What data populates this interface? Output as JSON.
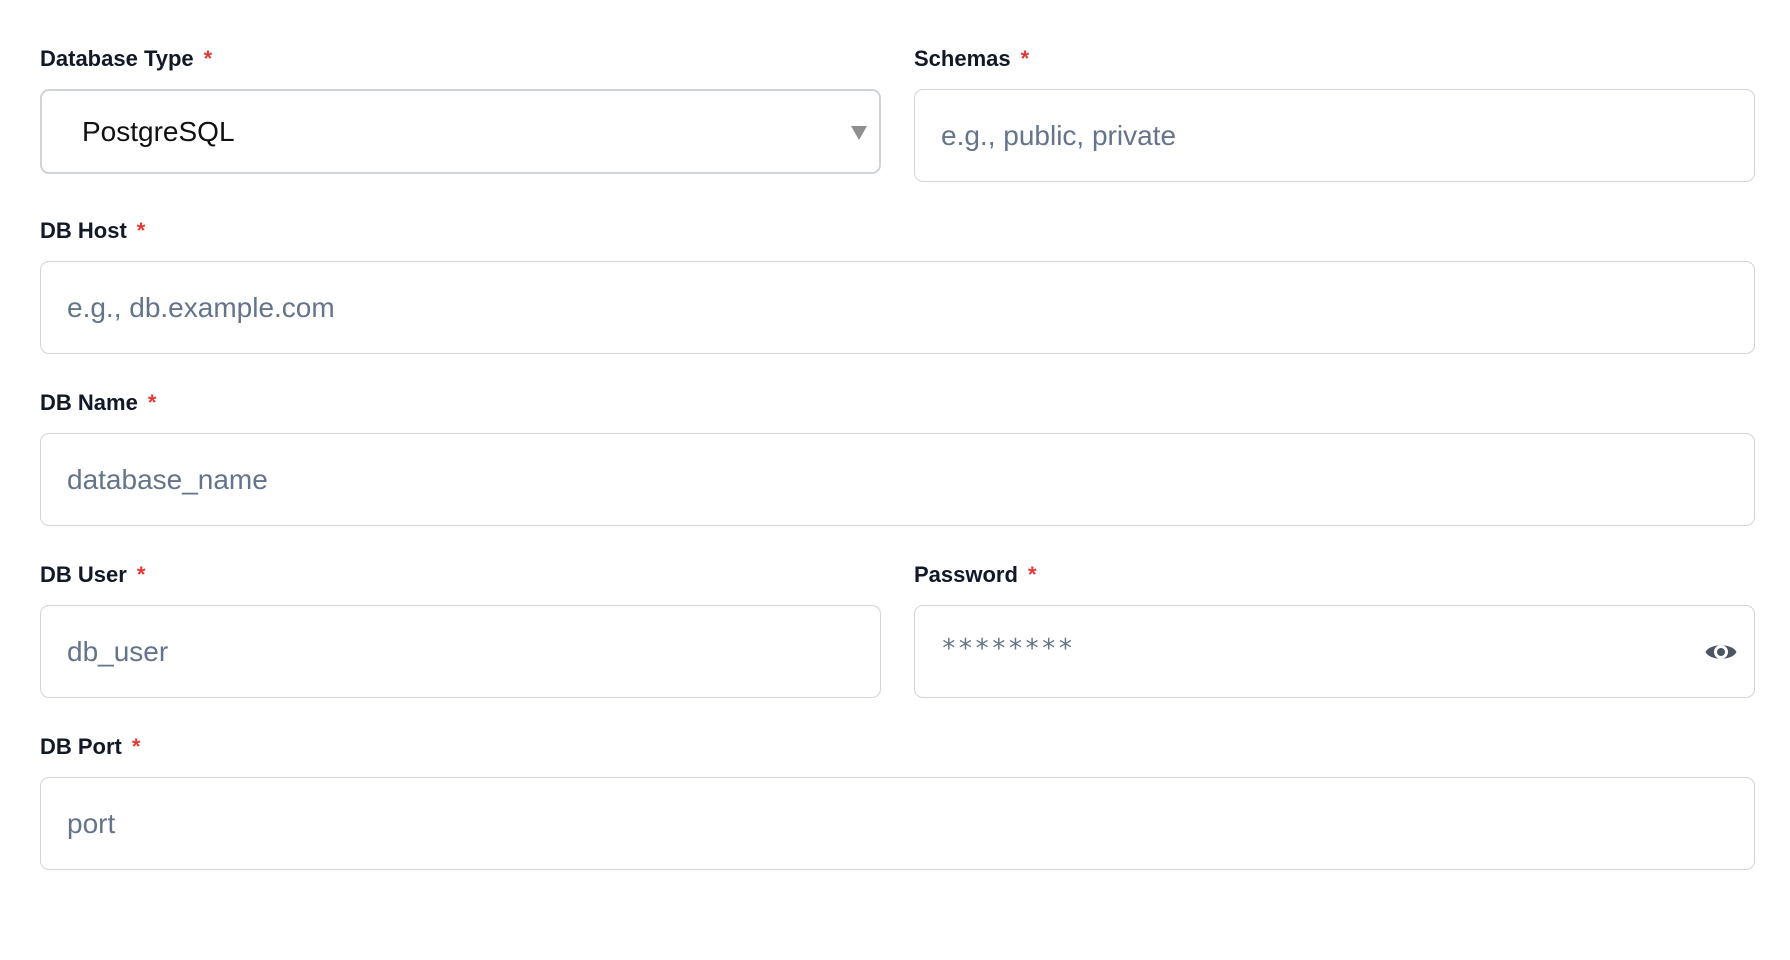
{
  "form": {
    "database_type": {
      "label": "Database Type",
      "required_mark": "*",
      "value": "PostgreSQL"
    },
    "schemas": {
      "label": "Schemas",
      "required_mark": "*",
      "placeholder": "e.g., public, private"
    },
    "db_host": {
      "label": "DB Host",
      "required_mark": "*",
      "placeholder": "e.g., db.example.com"
    },
    "db_name": {
      "label": "DB Name",
      "required_mark": "*",
      "placeholder": "database_name"
    },
    "db_user": {
      "label": "DB User",
      "required_mark": "*",
      "placeholder": "db_user"
    },
    "password": {
      "label": "Password",
      "required_mark": "*",
      "value_masked": "********",
      "toggle_icon": "eye-icon"
    },
    "db_port": {
      "label": "DB Port",
      "required_mark": "*",
      "placeholder": "port"
    }
  },
  "colors": {
    "label_text": "#111827",
    "required_mark": "#e53935",
    "placeholder_text": "#64748b",
    "border": "#d1d5db",
    "select_arrow": "#8f8f8f"
  }
}
